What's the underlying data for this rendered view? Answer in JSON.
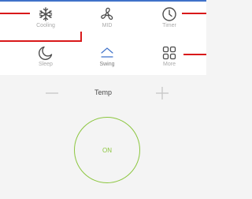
{
  "modes": {
    "cooling": {
      "label": "Cooling",
      "icon": "snowflake-icon"
    },
    "fan": {
      "label": "MID",
      "icon": "fan-icon"
    },
    "timer": {
      "label": "Timer",
      "icon": "clock-icon"
    },
    "sleep": {
      "label": "Sleep",
      "icon": "moon-icon"
    },
    "swing": {
      "label": "Swing",
      "icon": "chevron-up-icon"
    },
    "more": {
      "label": "More",
      "icon": "grid-icon"
    }
  },
  "temperature": {
    "label": "Temp",
    "decrease_icon": "minus-icon",
    "increase_icon": "plus-icon"
  },
  "power": {
    "label": "ON"
  },
  "colors": {
    "accent_blue": "#3f72c9",
    "power_green": "#8cc63f",
    "callout_red": "#d9191a",
    "icon_dark": "#4d4d4d"
  }
}
